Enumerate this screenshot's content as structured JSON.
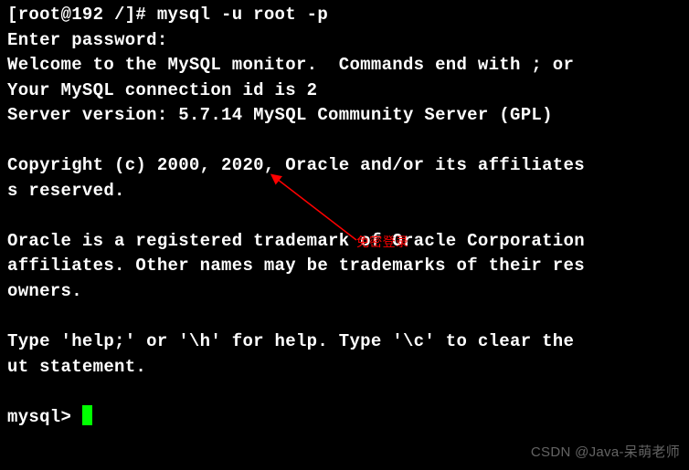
{
  "terminal": {
    "lines": [
      "[root@192 /]# mysql -u root -p",
      "Enter password:",
      "Welcome to the MySQL monitor.  Commands end with ; or ",
      "Your MySQL connection id is 2",
      "Server version: 5.7.14 MySQL Community Server (GPL)",
      "",
      "Copyright (c) 2000, 2020, Oracle and/or its affiliates",
      "s reserved.",
      "",
      "Oracle is a registered trademark of Oracle Corporation",
      "affiliates. Other names may be trademarks of their res",
      "owners.",
      "",
      "Type 'help;' or '\\h' for help. Type '\\c' to clear the ",
      "ut statement.",
      "",
      "mysql> "
    ]
  },
  "annotation": {
    "text": "免密登录"
  },
  "watermark": {
    "text": "CSDN @Java-呆萌老师"
  }
}
